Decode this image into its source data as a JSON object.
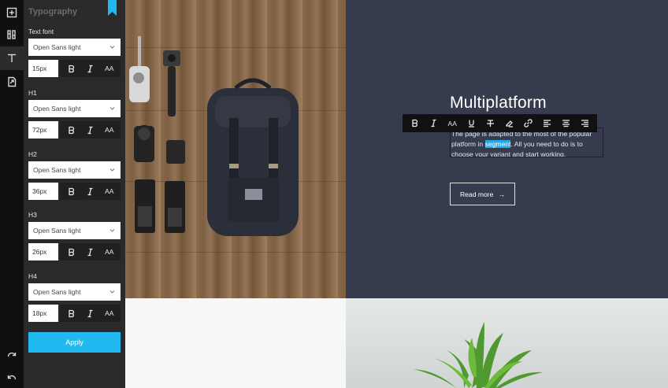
{
  "rail": {
    "items": [
      {
        "name": "add-icon"
      },
      {
        "name": "layout-icon"
      },
      {
        "name": "text-icon"
      },
      {
        "name": "export-icon"
      }
    ],
    "redo_icon": "redo-icon",
    "undo_icon": "undo-icon"
  },
  "panel": {
    "title": "Typography",
    "groups": [
      {
        "label": "Text font",
        "font": "Open Sans light",
        "size": "15px"
      },
      {
        "label": "H1",
        "font": "Open Sans light",
        "size": "72px"
      },
      {
        "label": "H2",
        "font": "Open Sans light",
        "size": "36px"
      },
      {
        "label": "H3",
        "font": "Open Sans light",
        "size": "26px"
      },
      {
        "label": "H4",
        "font": "Open Sans light",
        "size": "18px"
      }
    ],
    "format_glyphs": {
      "bold": "B",
      "italic": "I",
      "case": "AA"
    },
    "apply_label": "Apply",
    "accent_color": "#22b8f0"
  },
  "hero": {
    "title": "Multiplatform",
    "toolbar_case_glyph": "AA",
    "text_line1": "The page is adapted to the most of the popular",
    "text_line2_before": "platform in ",
    "text_highlight": "segment",
    "text_line2_after": ". All you need to do is to",
    "text_line3": "choose your variant and start working.",
    "read_more_label": "Read more",
    "read_more_arrow": "→",
    "background_color": "#363b4e"
  }
}
